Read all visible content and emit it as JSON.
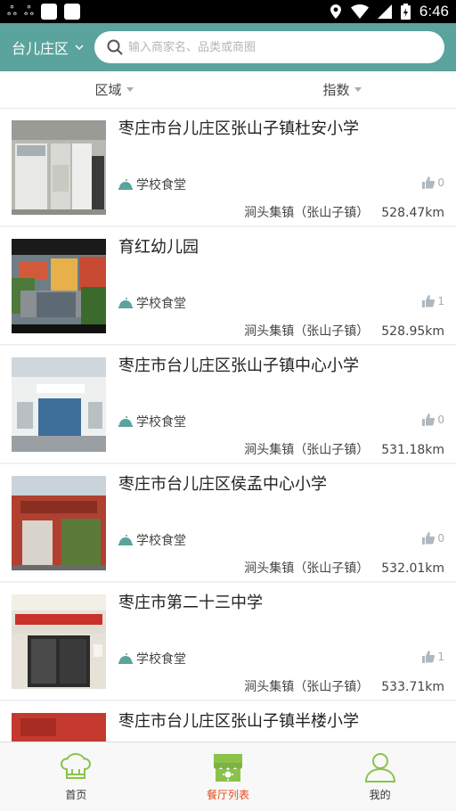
{
  "status_bar": {
    "time": "6:46"
  },
  "header": {
    "city": "台儿庄区",
    "search_placeholder": "输入商家名、品类或商圈"
  },
  "filters": [
    {
      "label": "区域"
    },
    {
      "label": "指数"
    }
  ],
  "restaurants": [
    {
      "name": "枣庄市台儿庄区张山子镇杜安小学",
      "category": "学校食堂",
      "likes": "0",
      "address": "涧头集镇（张山子镇）",
      "distance": "528.47km"
    },
    {
      "name": "育红幼儿园",
      "category": "学校食堂",
      "likes": "1",
      "address": "涧头集镇（张山子镇）",
      "distance": "528.95km"
    },
    {
      "name": "枣庄市台儿庄区张山子镇中心小学",
      "category": "学校食堂",
      "likes": "0",
      "address": "涧头集镇（张山子镇）",
      "distance": "531.18km"
    },
    {
      "name": "枣庄市台儿庄区侯孟中心小学",
      "category": "学校食堂",
      "likes": "0",
      "address": "涧头集镇（张山子镇）",
      "distance": "532.01km"
    },
    {
      "name": "枣庄市第二十三中学",
      "category": "学校食堂",
      "likes": "1",
      "address": "涧头集镇（张山子镇）",
      "distance": "533.71km"
    },
    {
      "name": "枣庄市台儿庄区张山子镇半楼小学",
      "category": "",
      "likes": "",
      "address": "",
      "distance": ""
    }
  ],
  "nav": {
    "home": "首页",
    "list": "餐厅列表",
    "mine": "我的",
    "active_color": "#e64a19",
    "accent_color": "#5ba39d",
    "icon_green": "#8bc34a"
  }
}
